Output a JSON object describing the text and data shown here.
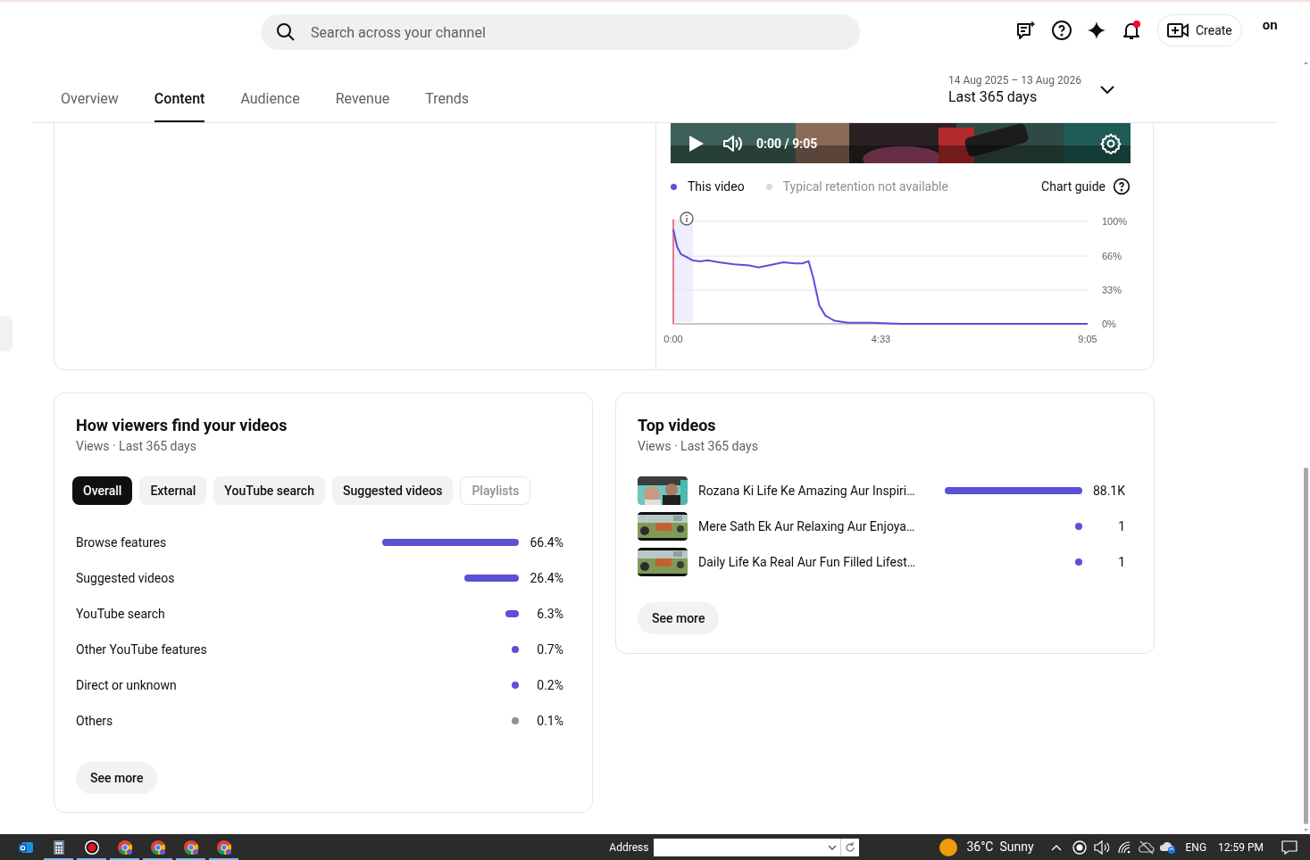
{
  "header": {
    "search": {
      "placeholder": "Search across your channel"
    },
    "notifications_unread": true,
    "create_label": "Create",
    "channel_logo": "on"
  },
  "tabs": [
    {
      "label": "Overview",
      "selected": false
    },
    {
      "label": "Content",
      "selected": true
    },
    {
      "label": "Audience",
      "selected": false
    },
    {
      "label": "Revenue",
      "selected": false
    },
    {
      "label": "Trends",
      "selected": false
    }
  ],
  "date_range": {
    "dates": "14 Aug 2025 – 13 Aug 2026",
    "label": "Last 365 days"
  },
  "retention": {
    "player": {
      "time": "0:00 / 9:05"
    },
    "legend": [
      {
        "label": "Typical retention not available",
        "color": "#d9d9d9",
        "available": false
      }
    ],
    "chart_guide": "Chart guide",
    "chart_data": {
      "type": "line",
      "x": [
        0,
        5,
        10,
        18,
        25,
        35,
        45,
        60,
        80,
        100,
        112,
        125,
        145,
        160,
        170,
        178,
        184,
        192,
        200,
        212,
        230,
        260,
        300,
        545
      ],
      "series": [
        {
          "name": "This video",
          "color": "#5b50d6",
          "values": [
            92,
            75,
            68,
            65,
            62,
            61,
            62,
            60,
            58,
            57,
            55,
            57,
            60,
            59,
            59,
            61,
            45,
            18,
            8,
            3,
            1,
            1,
            0,
            0
          ]
        }
      ],
      "xlim": [
        0,
        545
      ],
      "ylim": [
        0,
        100
      ],
      "xticks": [
        {
          "value": 0,
          "label": "0:00"
        },
        {
          "value": 273,
          "label": "4:33"
        },
        {
          "value": 545,
          "label": "9:05"
        }
      ],
      "yticks": [
        {
          "value": 0,
          "label": "0%"
        },
        {
          "value": 33,
          "label": "33%"
        },
        {
          "value": 66,
          "label": "66%"
        },
        {
          "value": 100,
          "label": "100%"
        }
      ]
    }
  },
  "traffic": {
    "title": "How viewers find your videos",
    "subtitle": "Views · Last 365 days",
    "chips": [
      {
        "label": "Overall",
        "selected": true,
        "disabled": false
      },
      {
        "label": "External",
        "selected": false,
        "disabled": false
      },
      {
        "label": "YouTube search",
        "selected": false,
        "disabled": false
      },
      {
        "label": "Suggested videos",
        "selected": false,
        "disabled": false
      },
      {
        "label": "Playlists",
        "selected": false,
        "disabled": true
      }
    ],
    "rows": [
      {
        "label": "Browse features",
        "value": "66.4%",
        "color": "#5b50d6"
      },
      {
        "label": "Suggested videos",
        "value": "26.4%",
        "color": "#5b50d6"
      },
      {
        "label": "YouTube search",
        "value": "6.3%",
        "color": "#5b50d6"
      },
      {
        "label": "Other YouTube features",
        "value": "0.7%",
        "color": "#5b50d6"
      },
      {
        "label": "Direct or unknown",
        "value": "0.2%",
        "color": "#5b50d6"
      },
      {
        "label": "Others",
        "value": "0.1%",
        "color": "#909090"
      }
    ],
    "see_more": "See more"
  },
  "top_videos": {
    "title": "Top videos",
    "subtitle": "Views · Last 365 days",
    "rows": [
      {
        "title": "Rozana Ki Life Ke Amazing Aur Inspiri…",
        "value": "88.1K"
      },
      {
        "title": "Mere Sath Ek Aur Relaxing Aur Enjoya…",
        "value": "1"
      },
      {
        "title": "Daily Life Ka Real Aur Fun Filled Lifest…",
        "value": "1"
      }
    ],
    "see_more": "See more"
  },
  "taskbar": {
    "apps": [
      {
        "kind": "mail",
        "running": false
      },
      {
        "kind": "calculator",
        "running": true
      },
      {
        "kind": "recorder",
        "running": true
      },
      {
        "kind": "browser",
        "running": true
      },
      {
        "kind": "browser",
        "running": true
      },
      {
        "kind": "browser",
        "running": true
      },
      {
        "kind": "browser",
        "running": true
      }
    ],
    "address_label": "Address",
    "weather": "36°C  Sunny",
    "language": "ENG",
    "time": "12:59 PM"
  }
}
